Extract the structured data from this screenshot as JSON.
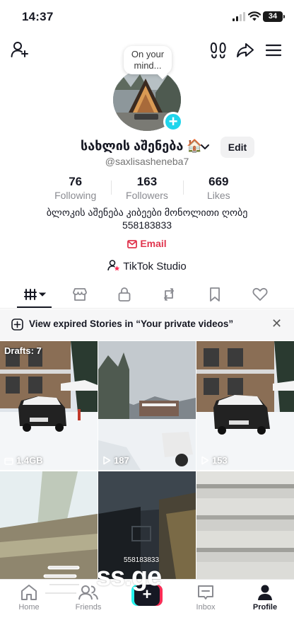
{
  "status_bar": {
    "time": "14:37",
    "battery": "34"
  },
  "profile": {
    "bubble_text": "On your mind...",
    "display_name": "სახლის აშენება 🏠",
    "edit_label": "Edit",
    "username": "@saxlisasheneba7",
    "stats": [
      {
        "value": "76",
        "label": "Following"
      },
      {
        "value": "163",
        "label": "Followers"
      },
      {
        "value": "669",
        "label": "Likes"
      }
    ],
    "bio_line1": "ბლოკის აშენება კიბეები მონოლითი ღობე",
    "bio_line2": "558183833",
    "email_label": "Email",
    "studio_label": "TikTok Studio"
  },
  "tabs": [
    "videos-tab",
    "shop-tab",
    "private-tab",
    "reposts-tab",
    "favorites-tab",
    "liked-tab"
  ],
  "banner": {
    "text": "View expired Stories in “Your private videos”"
  },
  "grid": {
    "drafts_label": "Drafts: 7",
    "cells": [
      {
        "label": "1.4GB",
        "icon": "storage-icon"
      },
      {
        "label": "187",
        "icon": "play-icon"
      },
      {
        "label": "153",
        "icon": "play-icon"
      },
      {
        "label": ""
      },
      {
        "label": "",
        "overlay": "558183833"
      },
      {
        "label": ""
      }
    ]
  },
  "watermark": {
    "text": "ss.ge"
  },
  "bottom_nav": {
    "home": "Home",
    "friends": "Friends",
    "inbox": "Inbox",
    "profile": "Profile"
  },
  "colors": {
    "accent_red": "#fe2c55",
    "accent_cyan": "#25f4ee",
    "email_red": "#e0364f",
    "plus_blue": "#20d5ec"
  }
}
